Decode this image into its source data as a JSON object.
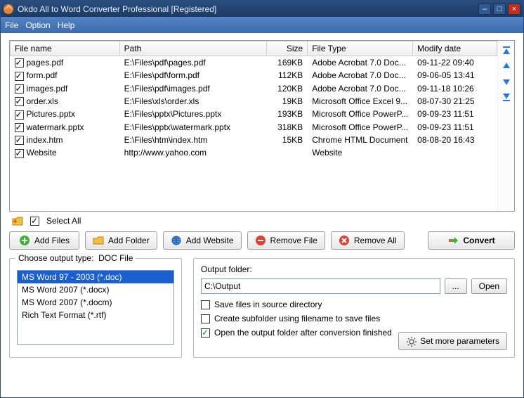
{
  "title": "Okdo All to Word Converter Professional [Registered]",
  "menu": {
    "file": "File",
    "option": "Option",
    "help": "Help"
  },
  "table": {
    "headers": {
      "name": "File name",
      "path": "Path",
      "size": "Size",
      "type": "File Type",
      "date": "Modify date"
    },
    "rows": [
      {
        "name": "pages.pdf",
        "path": "E:\\Files\\pdf\\pages.pdf",
        "size": "169KB",
        "type": "Adobe Acrobat 7.0 Doc...",
        "date": "09-11-22 09:40"
      },
      {
        "name": "form.pdf",
        "path": "E:\\Files\\pdf\\form.pdf",
        "size": "112KB",
        "type": "Adobe Acrobat 7.0 Doc...",
        "date": "09-06-05 13:41"
      },
      {
        "name": "images.pdf",
        "path": "E:\\Files\\pdf\\images.pdf",
        "size": "120KB",
        "type": "Adobe Acrobat 7.0 Doc...",
        "date": "09-11-18 10:26"
      },
      {
        "name": "order.xls",
        "path": "E:\\Files\\xls\\order.xls",
        "size": "19KB",
        "type": "Microsoft Office Excel 9...",
        "date": "08-07-30 21:25"
      },
      {
        "name": "Pictures.pptx",
        "path": "E:\\Files\\pptx\\Pictures.pptx",
        "size": "193KB",
        "type": "Microsoft Office PowerP...",
        "date": "09-09-23 11:51"
      },
      {
        "name": "watermark.pptx",
        "path": "E:\\Files\\pptx\\watermark.pptx",
        "size": "318KB",
        "type": "Microsoft Office PowerP...",
        "date": "09-09-23 11:51"
      },
      {
        "name": "index.htm",
        "path": "E:\\Files\\htm\\index.htm",
        "size": "15KB",
        "type": "Chrome HTML Document",
        "date": "08-08-20 16:43"
      },
      {
        "name": "Website",
        "path": "http://www.yahoo.com",
        "size": "",
        "type": "Website",
        "date": ""
      }
    ]
  },
  "select_all": "Select All",
  "buttons": {
    "add_files": "Add Files",
    "add_folder": "Add Folder",
    "add_website": "Add Website",
    "remove_file": "Remove File",
    "remove_all": "Remove All",
    "convert": "Convert"
  },
  "output_type": {
    "label": "Choose output type:",
    "current": "DOC File",
    "options": [
      "MS Word 97 - 2003 (*.doc)",
      "MS Word 2007 (*.docx)",
      "MS Word 2007 (*.docm)",
      "Rich Text Format (*.rtf)"
    ],
    "selected_index": 0
  },
  "output": {
    "label": "Output folder:",
    "path": "C:\\Output",
    "browse": "...",
    "open": "Open",
    "save_in_source": "Save files in source directory",
    "create_subfolder": "Create subfolder using filename to save files",
    "open_after": "Open the output folder after conversion finished",
    "set_more": "Set more parameters"
  }
}
